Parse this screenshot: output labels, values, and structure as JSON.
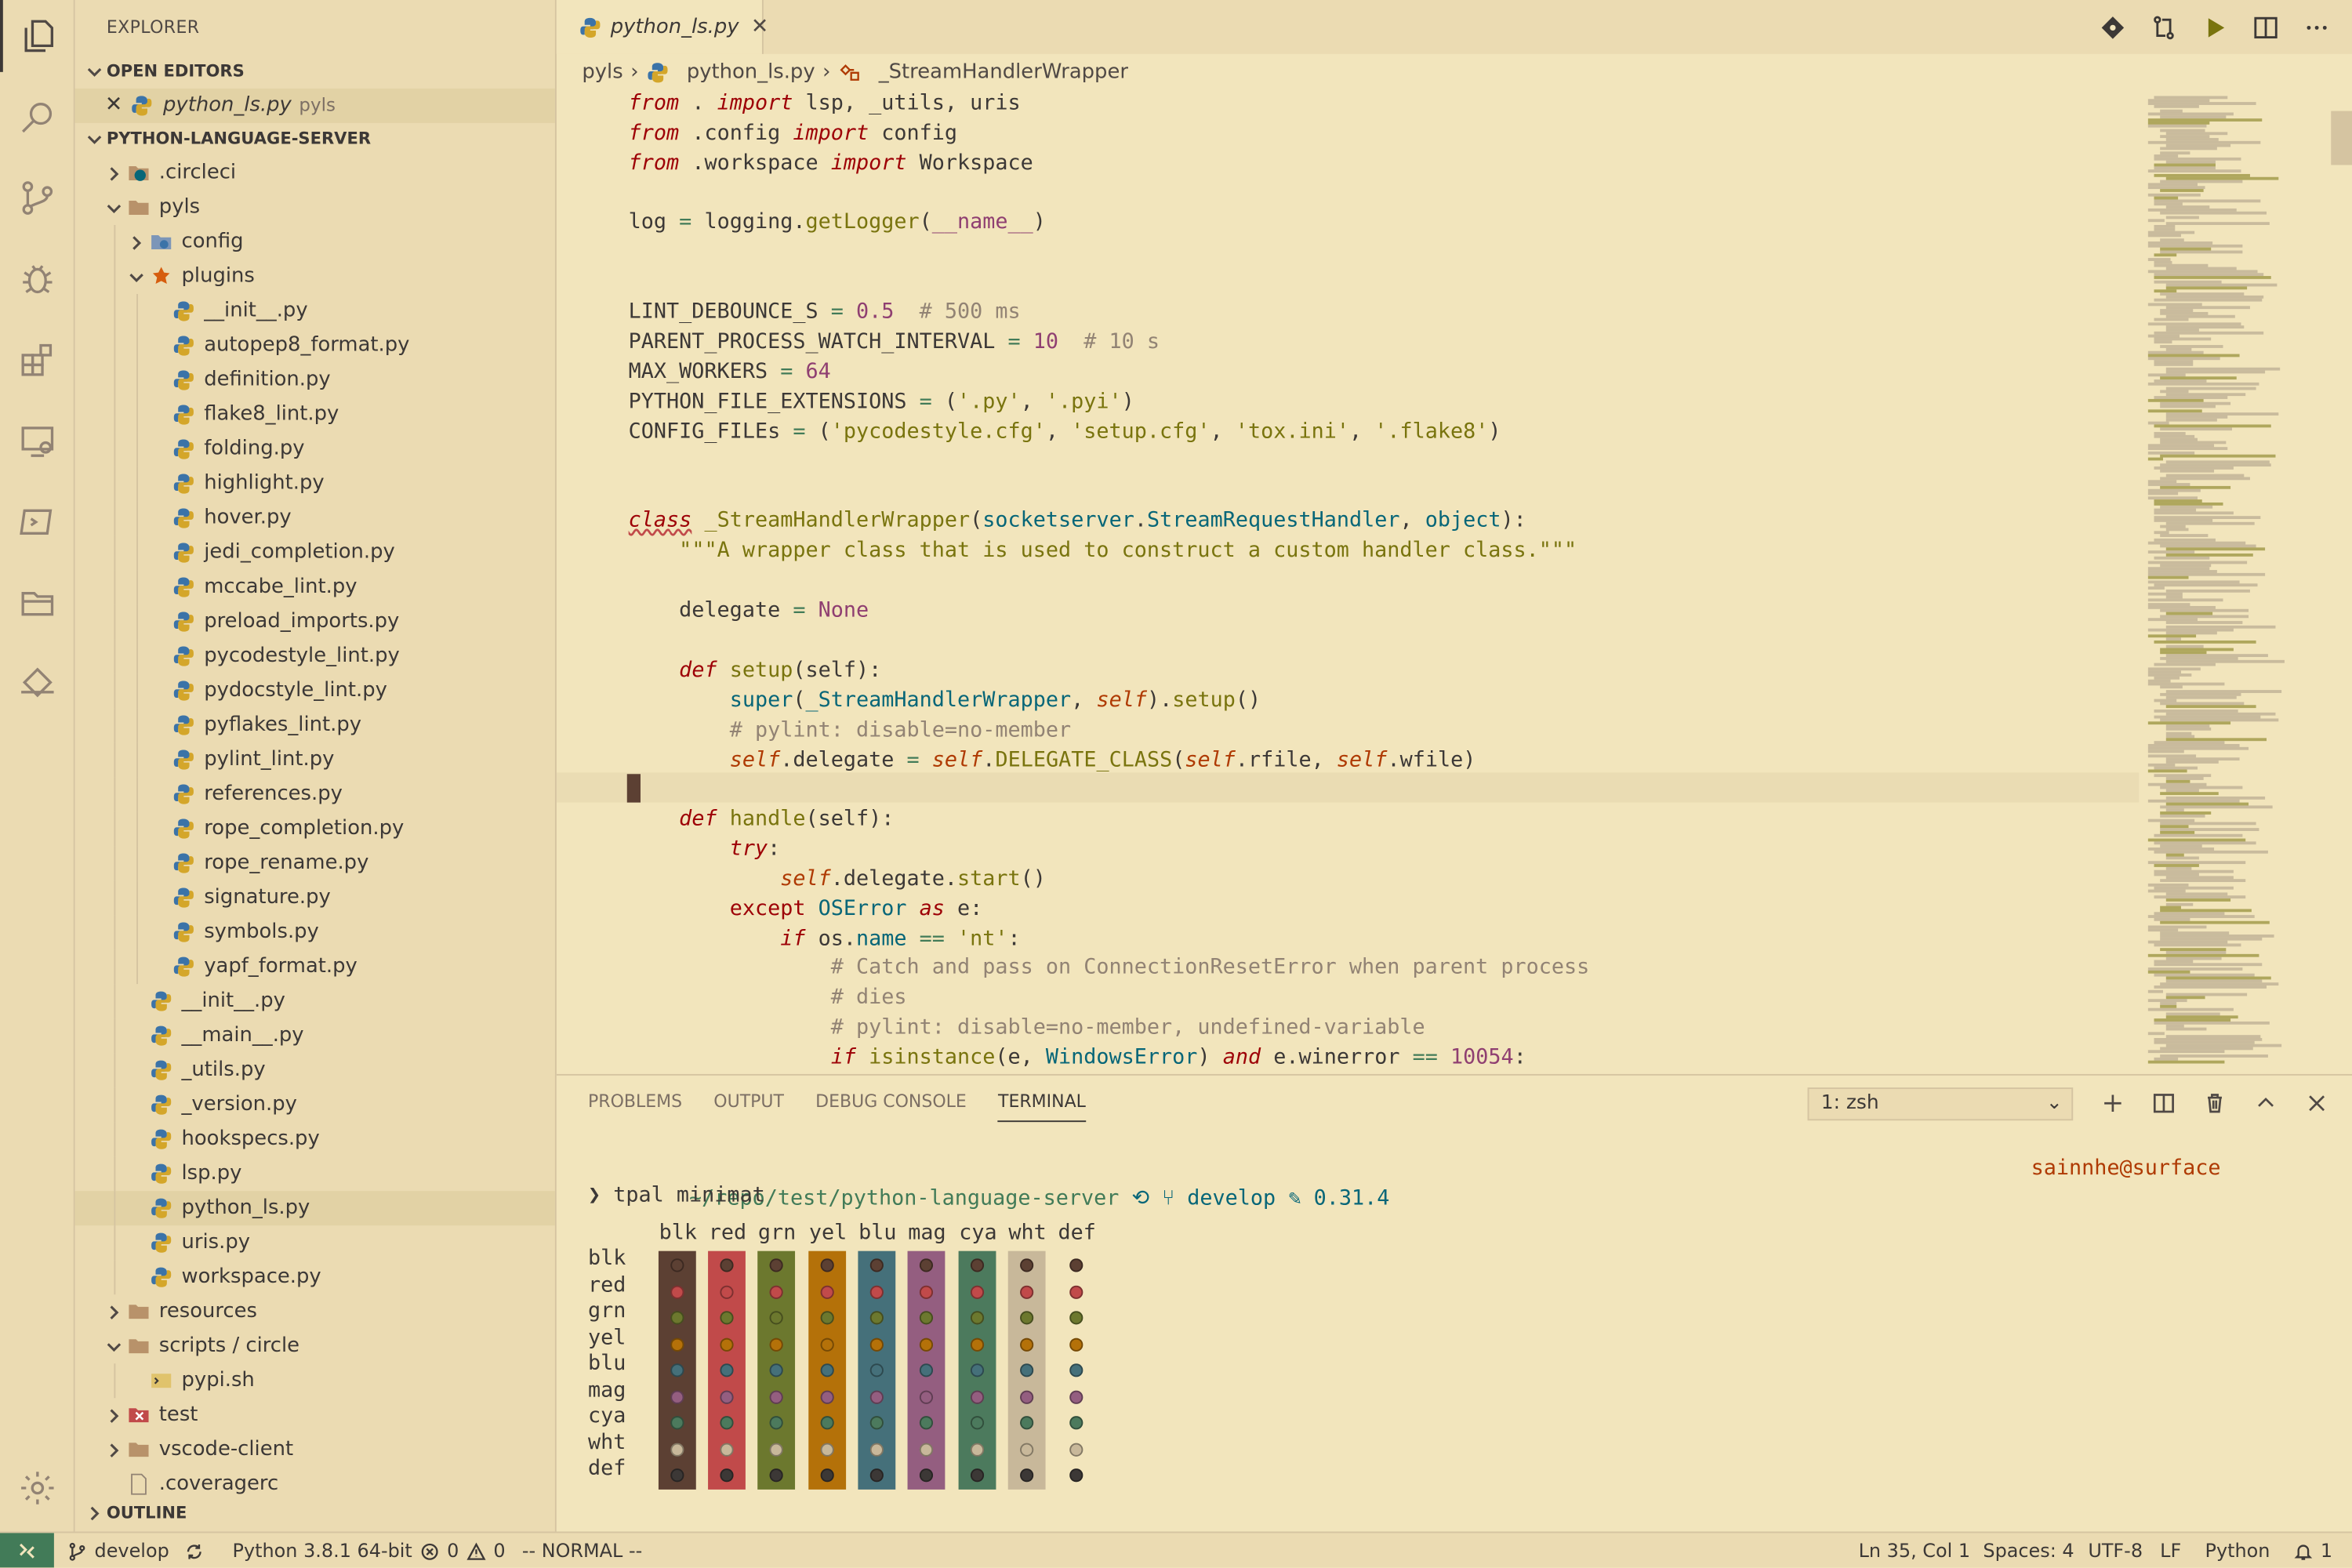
{
  "sidebar": {
    "title": "EXPLORER",
    "open_editors_label": "OPEN EDITORS",
    "open_editor_file": "python_ls.py",
    "open_editor_folder": "pyls",
    "project_label": "PYTHON-LANGUAGE-SERVER",
    "tree": [
      {
        "label": ".circleci",
        "type": "folder-circle",
        "level": 0,
        "open": false
      },
      {
        "label": "pyls",
        "type": "folder",
        "level": 0,
        "open": true
      },
      {
        "label": "config",
        "type": "folder-config",
        "level": 1,
        "open": false
      },
      {
        "label": "plugins",
        "type": "folder-plugin",
        "level": 1,
        "open": true
      },
      {
        "label": "__init__.py",
        "type": "py",
        "level": 2
      },
      {
        "label": "autopep8_format.py",
        "type": "py",
        "level": 2
      },
      {
        "label": "definition.py",
        "type": "py",
        "level": 2
      },
      {
        "label": "flake8_lint.py",
        "type": "py",
        "level": 2
      },
      {
        "label": "folding.py",
        "type": "py",
        "level": 2
      },
      {
        "label": "highlight.py",
        "type": "py",
        "level": 2
      },
      {
        "label": "hover.py",
        "type": "py",
        "level": 2
      },
      {
        "label": "jedi_completion.py",
        "type": "py",
        "level": 2
      },
      {
        "label": "mccabe_lint.py",
        "type": "py",
        "level": 2
      },
      {
        "label": "preload_imports.py",
        "type": "py",
        "level": 2
      },
      {
        "label": "pycodestyle_lint.py",
        "type": "py",
        "level": 2
      },
      {
        "label": "pydocstyle_lint.py",
        "type": "py",
        "level": 2
      },
      {
        "label": "pyflakes_lint.py",
        "type": "py",
        "level": 2
      },
      {
        "label": "pylint_lint.py",
        "type": "py",
        "level": 2
      },
      {
        "label": "references.py",
        "type": "py",
        "level": 2
      },
      {
        "label": "rope_completion.py",
        "type": "py",
        "level": 2
      },
      {
        "label": "rope_rename.py",
        "type": "py",
        "level": 2
      },
      {
        "label": "signature.py",
        "type": "py",
        "level": 2
      },
      {
        "label": "symbols.py",
        "type": "py",
        "level": 2
      },
      {
        "label": "yapf_format.py",
        "type": "py",
        "level": 2
      },
      {
        "label": "__init__.py",
        "type": "py",
        "level": 1
      },
      {
        "label": "__main__.py",
        "type": "py",
        "level": 1
      },
      {
        "label": "_utils.py",
        "type": "py",
        "level": 1
      },
      {
        "label": "_version.py",
        "type": "py",
        "level": 1
      },
      {
        "label": "hookspecs.py",
        "type": "py",
        "level": 1
      },
      {
        "label": "lsp.py",
        "type": "py",
        "level": 1
      },
      {
        "label": "python_ls.py",
        "type": "py",
        "level": 1,
        "selected": true
      },
      {
        "label": "uris.py",
        "type": "py",
        "level": 1
      },
      {
        "label": "workspace.py",
        "type": "py",
        "level": 1
      },
      {
        "label": "resources",
        "type": "folder",
        "level": 0,
        "open": false
      },
      {
        "label": "scripts / circle",
        "type": "folder",
        "level": 0,
        "open": true
      },
      {
        "label": "pypi.sh",
        "type": "sh",
        "level": 1
      },
      {
        "label": "test",
        "type": "folder-test",
        "level": 0,
        "open": false
      },
      {
        "label": "vscode-client",
        "type": "folder",
        "level": 0,
        "open": false
      },
      {
        "label": ".coveragerc",
        "type": "file",
        "level": 0
      }
    ],
    "outline_label": "OUTLINE"
  },
  "editor": {
    "tab_label": "python_ls.py",
    "breadcrumb": [
      "pyls",
      "python_ls.py",
      "_StreamHandlerWrapper"
    ]
  },
  "panel": {
    "tabs": [
      "PROBLEMS",
      "OUTPUT",
      "DEBUG CONSOLE",
      "TERMINAL"
    ],
    "active_tab": "TERMINAL",
    "terminal_select": "1: zsh",
    "prompt_path": "~/repo/test/python-language-server",
    "prompt_branch": "develop",
    "prompt_tag": "0.31.4",
    "prompt_host": "sainnhe@surface",
    "command": "tpal minimat",
    "palette_cols": [
      "blk",
      "red",
      "grn",
      "yel",
      "blu",
      "mag",
      "cya",
      "wht",
      "def"
    ],
    "palette_rows": [
      "blk",
      "red",
      "grn",
      "yel",
      "blu",
      "mag",
      "cya",
      "wht",
      "def"
    ],
    "palette_colors": [
      "#5c4033",
      "#c14a4a",
      "#6c782e",
      "#b47109",
      "#45707a",
      "#945e80",
      "#4c7a5d",
      "#c8b89a",
      ""
    ]
  },
  "status": {
    "branch": "develop",
    "python": "Python 3.8.1 64-bit",
    "errors": "0",
    "warnings": "0",
    "mode": "-- NORMAL --",
    "position": "Ln 35, Col 1",
    "spaces": "Spaces: 4",
    "encoding": "UTF-8",
    "eol": "LF",
    "language": "Python",
    "notifications": "1"
  }
}
